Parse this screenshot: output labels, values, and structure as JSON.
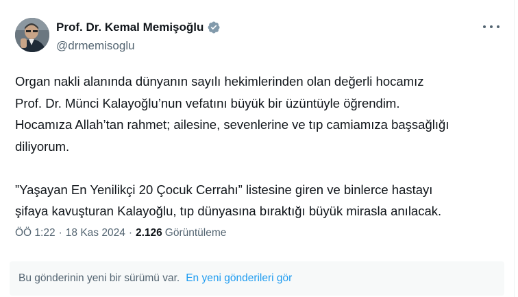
{
  "author": {
    "name": "Prof. Dr. Kemal Memişoğlu",
    "handle": "@drmemisoglu",
    "verified_icon": "verified-badge-icon",
    "avatar_icon": "profile-photo"
  },
  "menu": {
    "icon": "more-options-icon"
  },
  "tweet": {
    "paragraph1": "Organ nakli alanında dünyanın sayılı hekimlerinden olan değerli hocamız\nProf. Dr. Münci Kalayoğlu’nun vefatını büyük bir üzüntüyle öğrendim.\nHocamıza Allah’tan rahmet; ailesine, sevenlerine ve tıp camiamıza başsağlığı\ndiliyorum.",
    "paragraph2": "”Yaşayan En Yenilikçi 20 Çocuk Cerrahı” listesine giren ve binlerce hastayı\nşifaya kavuşturan Kalayoğlu, tıp dünyasına bıraktığı büyük mirasla anılacak."
  },
  "meta": {
    "time": "ÖÖ 1:22",
    "separator": "·",
    "date": "18 Kas 2024",
    "views_count": "2.126",
    "views_label": "Görüntüleme"
  },
  "notice": {
    "text": "Bu gönderinin yeni bir sürümü var.",
    "link": "En yeni gönderileri gör"
  },
  "colors": {
    "text": "#0f1419",
    "secondary": "#536471",
    "link": "#1d9bf0",
    "notice_bg": "#f7f9f9"
  }
}
